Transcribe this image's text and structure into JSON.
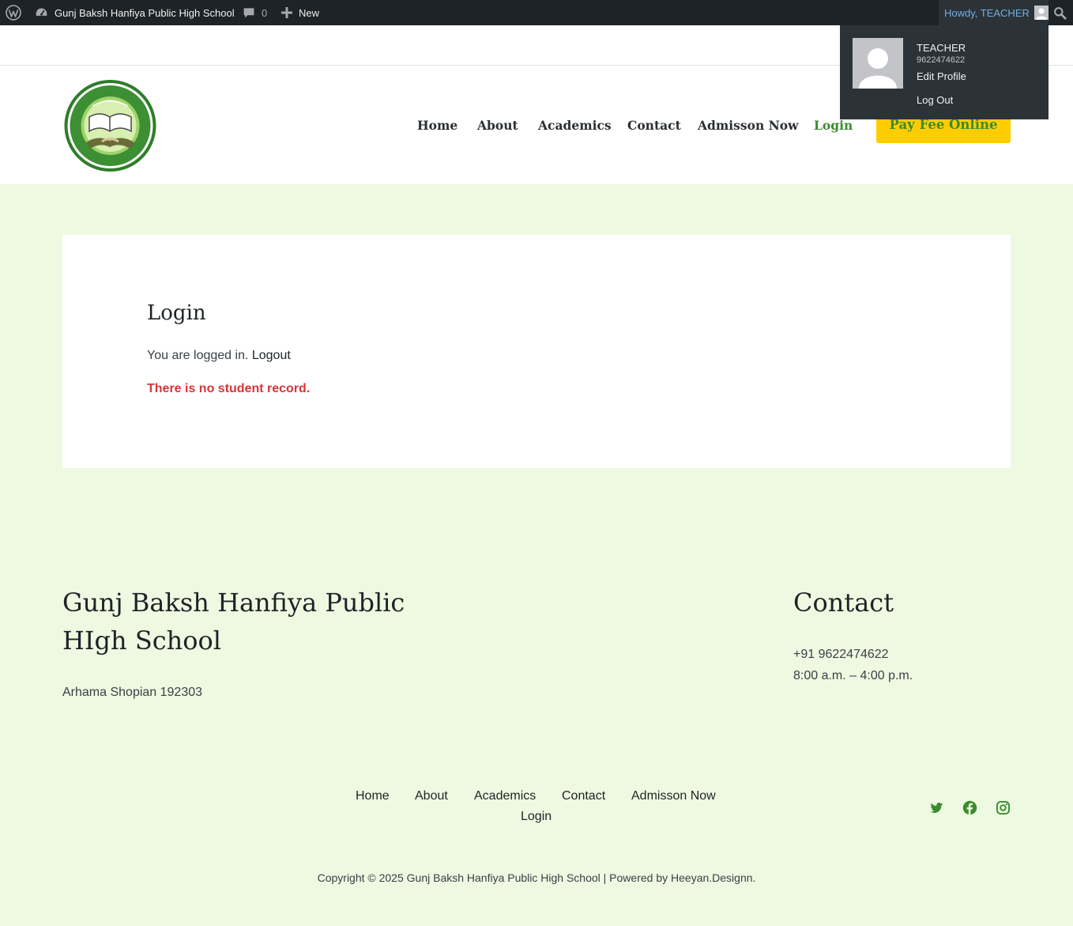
{
  "admin_bar": {
    "site_name": "Gunj Baksh Hanfiya Public High School",
    "comments_count": "0",
    "new_label": "New",
    "howdy": "Howdy, TEACHER",
    "dropdown": {
      "display_name": "TEACHER",
      "username": "9622474622",
      "edit_profile": "Edit Profile",
      "log_out": "Log Out"
    }
  },
  "header": {
    "nav": [
      "Home",
      "About",
      "Academics",
      "Contact",
      "Admisson Now",
      "Login"
    ],
    "active_item": "Login",
    "cta_label": "Pay Fee Online"
  },
  "content": {
    "title": "Login",
    "logged_in_text": "You are logged in. ",
    "logout_link": "Logout",
    "notice": "There is no student record."
  },
  "footer": {
    "school_name": "Gunj Baksh Hanfiya Public HIgh School",
    "address": "Arhama Shopian 192303",
    "contact_title": "Contact",
    "phone": "+91 9622474622",
    "hours": "8:00 a.m. – 4:00 p.m.",
    "nav": [
      "Home",
      "About",
      "Academics",
      "Contact",
      "Admisson Now",
      "Login"
    ],
    "social": [
      "twitter-icon",
      "facebook-icon",
      "instagram-icon"
    ],
    "copyright": "Copyright © 2025 Gunj Baksh Hanfiya Public High School | Powered by Heeyan.Designn."
  },
  "colors": {
    "admin_bar_bg": "#1d2327",
    "page_bg": "#edf9e1",
    "accent_green": "#3b8c2e",
    "cta_yellow": "#ffcc00",
    "error_red": "#d63638"
  }
}
